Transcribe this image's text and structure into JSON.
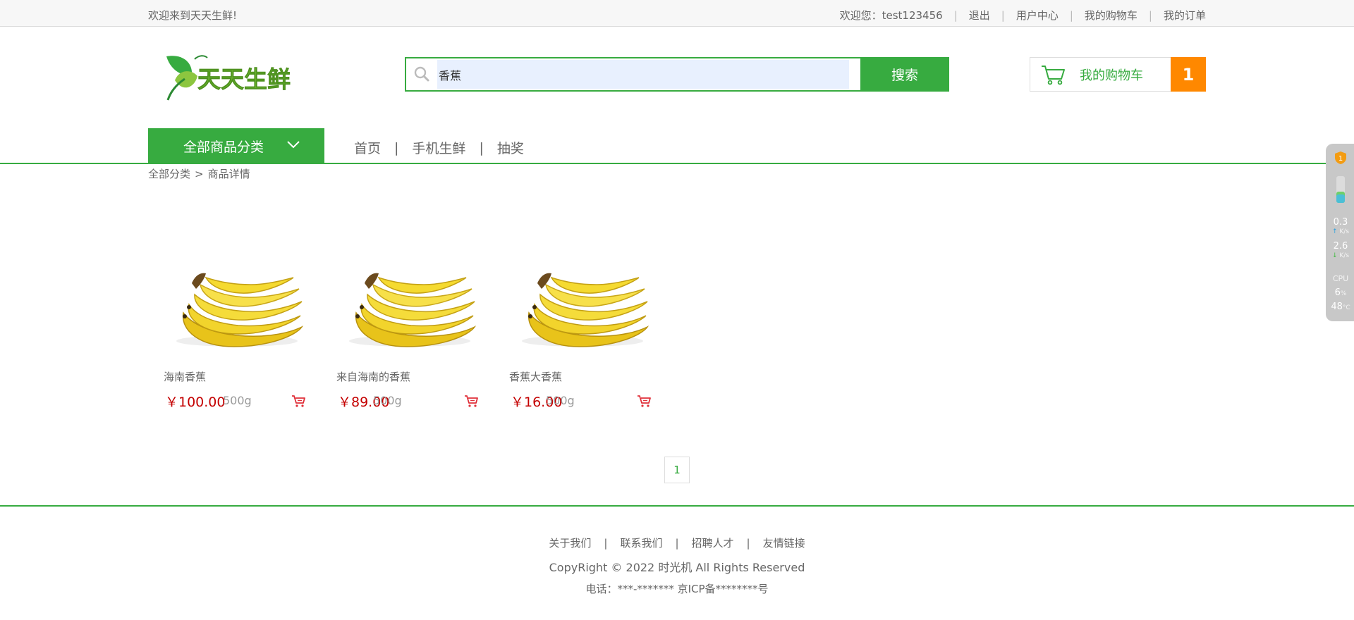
{
  "topbar": {
    "welcome": "欢迎来到天天生鲜!",
    "user_greeting": "欢迎您：test123456",
    "logout": "退出",
    "user_center": "用户中心",
    "my_cart": "我的购物车",
    "my_orders": "我的订单"
  },
  "header": {
    "logo_text": "天天生鲜",
    "search": {
      "value": "香蕉",
      "button": "搜索"
    },
    "cart": {
      "label": "我的购物车",
      "count": "1"
    }
  },
  "nav": {
    "all_categories": "全部商品分类",
    "links": [
      "首页",
      "手机生鲜",
      "抽奖"
    ],
    "separator": "|"
  },
  "breadcrumb": {
    "root": "全部分类",
    "sep": ">",
    "current": "商品详情"
  },
  "products": [
    {
      "name": "海南香蕉",
      "price": "￥100.00",
      "unit": "500g",
      "image": "banana-image"
    },
    {
      "name": "来自海南的香蕉",
      "price": "￥89.00",
      "unit": "500g",
      "image": "banana-image"
    },
    {
      "name": "香蕉大香蕉",
      "price": "￥16.00",
      "unit": "500g",
      "image": "banana-image"
    }
  ],
  "pagination": {
    "current": "1"
  },
  "footer": {
    "links": [
      "关于我们",
      "联系我们",
      "招聘人才",
      "友情链接"
    ],
    "separator": "|",
    "copyright": "CopyRight © 2022 时光机 All Rights Reserved",
    "contact": "电话：***-******* 京ICP备********号"
  },
  "side_widget": {
    "upload": "0.3",
    "upload_unit": "K/s",
    "download": "2.6",
    "download_unit": "K/s",
    "cpu_label": "CPU",
    "cpu_value": "6",
    "cpu_unit": "%",
    "temp_value": "48",
    "temp_unit": "°C",
    "shield_badge": "1"
  },
  "colors": {
    "brand_green": "#37ab40",
    "cart_orange": "#ff8800",
    "price_red": "#c40000"
  }
}
